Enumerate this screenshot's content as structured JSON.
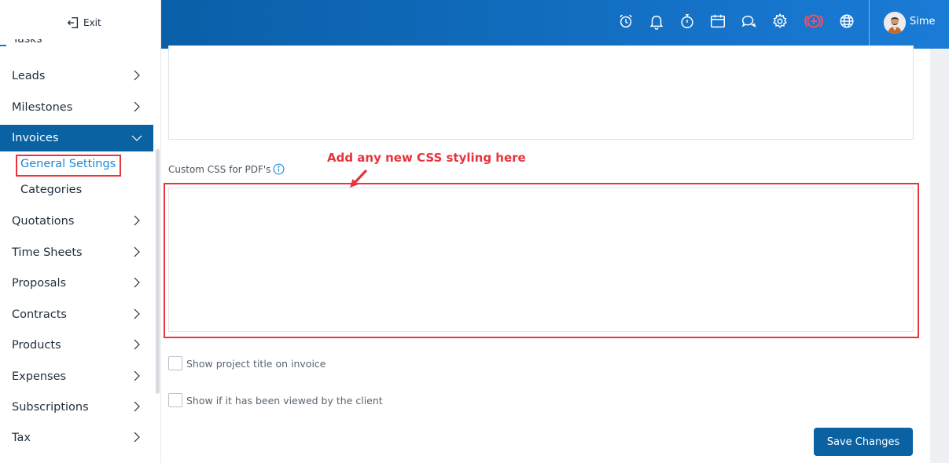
{
  "sidebar": {
    "exit_label": "Exit",
    "partial_item": "Tasks",
    "items": [
      {
        "label": "Leads"
      },
      {
        "label": "Milestones"
      },
      {
        "label": "Invoices",
        "expanded": true,
        "active": true
      },
      {
        "label": "Quotations"
      },
      {
        "label": "Time Sheets"
      },
      {
        "label": "Proposals"
      },
      {
        "label": "Contracts"
      },
      {
        "label": "Products"
      },
      {
        "label": "Expenses"
      },
      {
        "label": "Subscriptions"
      },
      {
        "label": "Tax"
      }
    ],
    "invoice_subitems": [
      {
        "label": "General Settings",
        "current": true
      },
      {
        "label": "Categories"
      }
    ]
  },
  "topbar": {
    "icons": [
      "alarm-clock-icon",
      "bell-icon",
      "stopwatch-icon",
      "calendar-icon",
      "chat-icon",
      "gear-icon",
      "add-circle-icon",
      "globe-icon"
    ],
    "user_name": "Sime"
  },
  "main": {
    "annotation": "Add any new CSS styling here",
    "custom_css_label": "Custom CSS for PDF's",
    "custom_css_value": "",
    "checkboxes": [
      {
        "label": "Show project title on invoice",
        "checked": false
      },
      {
        "label": "Show if it has been viewed by the client",
        "checked": false
      }
    ],
    "save_label": "Save Changes"
  },
  "colors": {
    "primary": "#0a62a3",
    "accent_link": "#1a8ad8",
    "annotation_red": "#e8343c",
    "topbar_gradient_start": "#0a5fa8",
    "topbar_gradient_end": "#1a7bd6",
    "add_icon": "#ff4d5e"
  }
}
